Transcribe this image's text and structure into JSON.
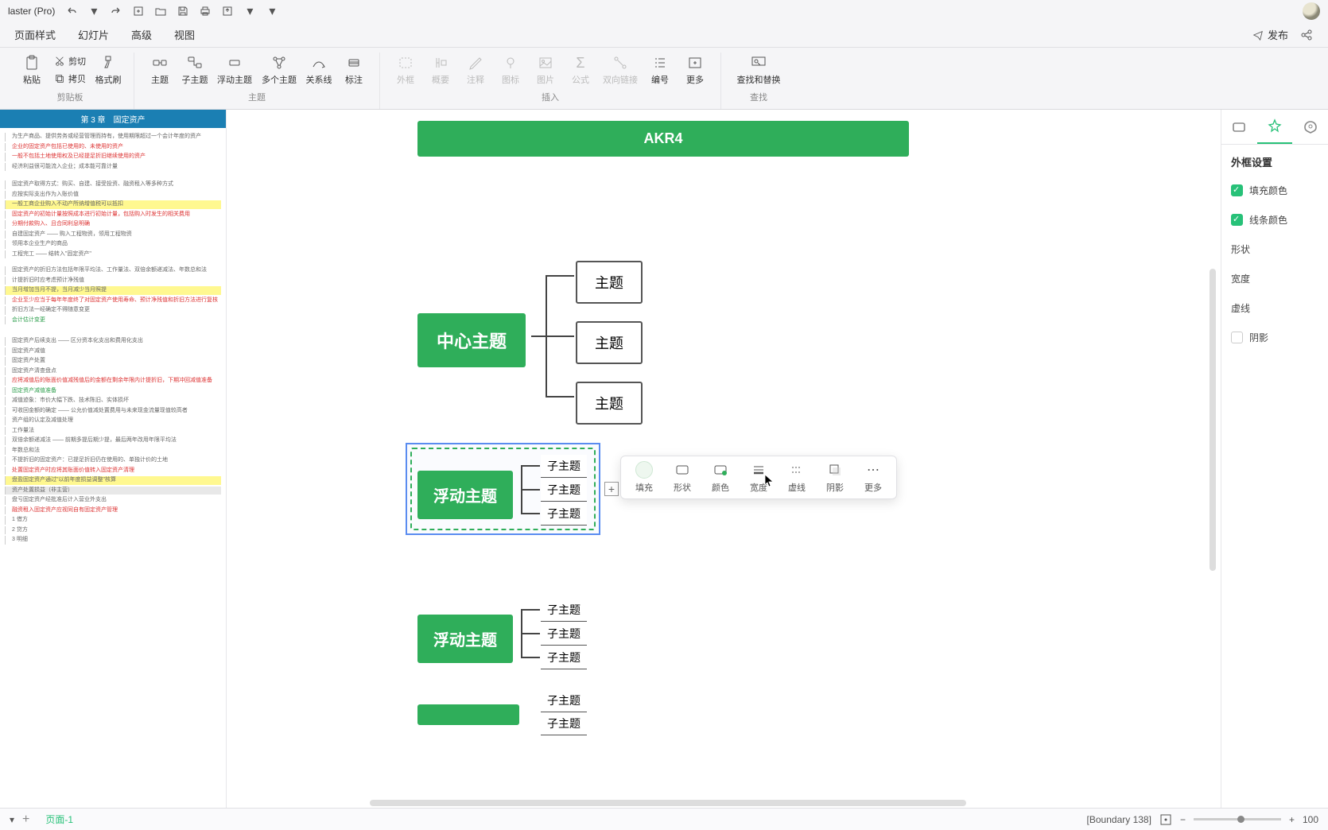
{
  "app": {
    "title": "laster (Pro)"
  },
  "menubar": {
    "items": [
      "页面样式",
      "幻灯片",
      "高级",
      "视图"
    ],
    "publish": "发布"
  },
  "ribbon": {
    "groups": {
      "clipboard": {
        "paste": "粘贴",
        "cut": "剪切",
        "copy": "拷贝",
        "format": "格式刷",
        "label": "剪贴板"
      },
      "topic": {
        "topic": "主题",
        "subtopic": "子主题",
        "floating": "浮动主题",
        "multi": "多个主题",
        "relation": "关系线",
        "marker": "标注",
        "label": "主题"
      },
      "insert": {
        "frame": "外框",
        "summary": "概要",
        "note": "注释",
        "icon": "图标",
        "image": "图片",
        "formula": "公式",
        "twolink": "双向链接",
        "number": "编号",
        "more": "更多",
        "label": "插入"
      },
      "find": {
        "find": "查找和替换",
        "label": "查找"
      }
    }
  },
  "outline": {
    "header": "第 3 章　固定资产"
  },
  "canvas": {
    "title_node": "AKR4",
    "center": "中心主题",
    "children": [
      "主题",
      "主题",
      "主题"
    ],
    "float1": "浮动主题",
    "float1_subs": [
      "子主题",
      "子主题",
      "子主题"
    ],
    "float2": "浮动主题",
    "float2_subs": [
      "子主题",
      "子主题",
      "子主题"
    ],
    "float3_subs": [
      "子主题",
      "子主题"
    ]
  },
  "float_toolbar": {
    "fill": "填充",
    "shape": "形状",
    "color": "颜色",
    "width": "宽度",
    "dash": "虚线",
    "shadow": "阴影",
    "more": "更多"
  },
  "rpanel": {
    "title": "外框设置",
    "fill_color": "填充颜色",
    "line_color": "线条颜色",
    "shape": "形状",
    "width": "宽度",
    "dash": "虚线",
    "shadow": "阴影"
  },
  "statusbar": {
    "page_tab": "页面-1",
    "boundary": "[Boundary 138]",
    "zoom": "100"
  }
}
